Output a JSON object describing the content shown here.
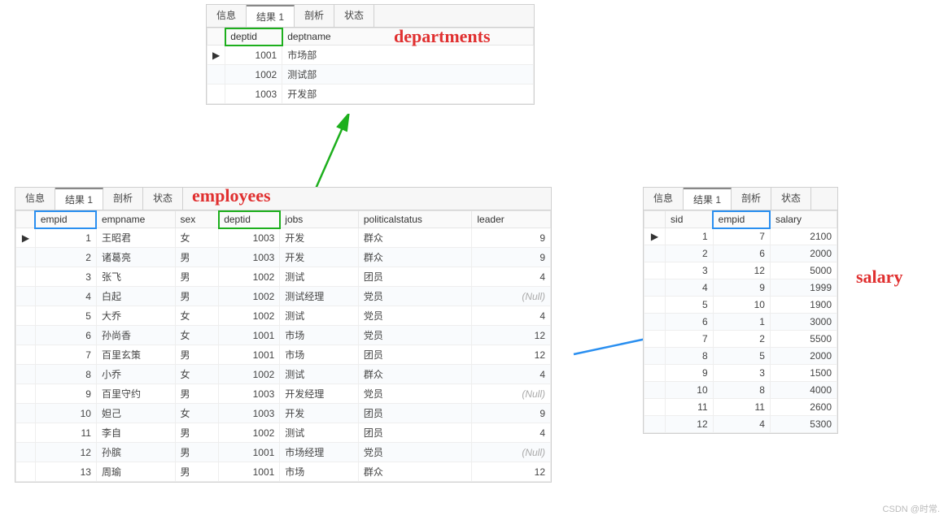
{
  "labels": {
    "departments": "departments",
    "employees": "employees",
    "salary": "salary",
    "watermark": "CSDN @时常."
  },
  "tabs": {
    "info": "信息",
    "result1": "结果 1",
    "profile": "剖析",
    "status": "状态"
  },
  "departments": {
    "headers": {
      "rowptr": "",
      "deptid": "deptid",
      "deptname": "deptname"
    },
    "rows": [
      {
        "ptr": "▶",
        "deptid": "1001",
        "deptname": "市场部"
      },
      {
        "ptr": "",
        "deptid": "1002",
        "deptname": "测试部"
      },
      {
        "ptr": "",
        "deptid": "1003",
        "deptname": "开发部"
      }
    ]
  },
  "employees": {
    "headers": {
      "rowptr": "",
      "empid": "empid",
      "empname": "empname",
      "sex": "sex",
      "deptid": "deptid",
      "jobs": "jobs",
      "politicalstatus": "politicalstatus",
      "leader": "leader"
    },
    "rows": [
      {
        "ptr": "▶",
        "empid": "1",
        "empname": "王昭君",
        "sex": "女",
        "deptid": "1003",
        "jobs": "开发",
        "pol": "群众",
        "leader": "9"
      },
      {
        "ptr": "",
        "empid": "2",
        "empname": "诸葛亮",
        "sex": "男",
        "deptid": "1003",
        "jobs": "开发",
        "pol": "群众",
        "leader": "9"
      },
      {
        "ptr": "",
        "empid": "3",
        "empname": "张飞",
        "sex": "男",
        "deptid": "1002",
        "jobs": "测试",
        "pol": "团员",
        "leader": "4"
      },
      {
        "ptr": "",
        "empid": "4",
        "empname": "白起",
        "sex": "男",
        "deptid": "1002",
        "jobs": "测试经理",
        "pol": "党员",
        "leader_null": "(Null)"
      },
      {
        "ptr": "",
        "empid": "5",
        "empname": "大乔",
        "sex": "女",
        "deptid": "1002",
        "jobs": "测试",
        "pol": "党员",
        "leader": "4"
      },
      {
        "ptr": "",
        "empid": "6",
        "empname": "孙尚香",
        "sex": "女",
        "deptid": "1001",
        "jobs": "市场",
        "pol": "党员",
        "leader": "12"
      },
      {
        "ptr": "",
        "empid": "7",
        "empname": "百里玄策",
        "sex": "男",
        "deptid": "1001",
        "jobs": "市场",
        "pol": "团员",
        "leader": "12"
      },
      {
        "ptr": "",
        "empid": "8",
        "empname": "小乔",
        "sex": "女",
        "deptid": "1002",
        "jobs": "测试",
        "pol": "群众",
        "leader": "4"
      },
      {
        "ptr": "",
        "empid": "9",
        "empname": "百里守约",
        "sex": "男",
        "deptid": "1003",
        "jobs": "开发经理",
        "pol": "党员",
        "leader_null": "(Null)"
      },
      {
        "ptr": "",
        "empid": "10",
        "empname": "妲己",
        "sex": "女",
        "deptid": "1003",
        "jobs": "开发",
        "pol": "团员",
        "leader": "9"
      },
      {
        "ptr": "",
        "empid": "11",
        "empname": "李自",
        "sex": "男",
        "deptid": "1002",
        "jobs": "测试",
        "pol": "团员",
        "leader": "4"
      },
      {
        "ptr": "",
        "empid": "12",
        "empname": "孙膑",
        "sex": "男",
        "deptid": "1001",
        "jobs": "市场经理",
        "pol": "党员",
        "leader_null": "(Null)"
      },
      {
        "ptr": "",
        "empid": "13",
        "empname": "周瑜",
        "sex": "男",
        "deptid": "1001",
        "jobs": "市场",
        "pol": "群众",
        "leader": "12"
      }
    ]
  },
  "salary": {
    "headers": {
      "rowptr": "",
      "sid": "sid",
      "empid": "empid",
      "salary": "salary"
    },
    "rows": [
      {
        "ptr": "▶",
        "sid": "1",
        "empid": "7",
        "salary": "2100"
      },
      {
        "ptr": "",
        "sid": "2",
        "empid": "6",
        "salary": "2000"
      },
      {
        "ptr": "",
        "sid": "3",
        "empid": "12",
        "salary": "5000"
      },
      {
        "ptr": "",
        "sid": "4",
        "empid": "9",
        "salary": "1999"
      },
      {
        "ptr": "",
        "sid": "5",
        "empid": "10",
        "salary": "1900"
      },
      {
        "ptr": "",
        "sid": "6",
        "empid": "1",
        "salary": "3000"
      },
      {
        "ptr": "",
        "sid": "7",
        "empid": "2",
        "salary": "5500"
      },
      {
        "ptr": "",
        "sid": "8",
        "empid": "5",
        "salary": "2000"
      },
      {
        "ptr": "",
        "sid": "9",
        "empid": "3",
        "salary": "1500"
      },
      {
        "ptr": "",
        "sid": "10",
        "empid": "8",
        "salary": "4000"
      },
      {
        "ptr": "",
        "sid": "11",
        "empid": "11",
        "salary": "2600"
      },
      {
        "ptr": "",
        "sid": "12",
        "empid": "4",
        "salary": "5300"
      }
    ]
  }
}
